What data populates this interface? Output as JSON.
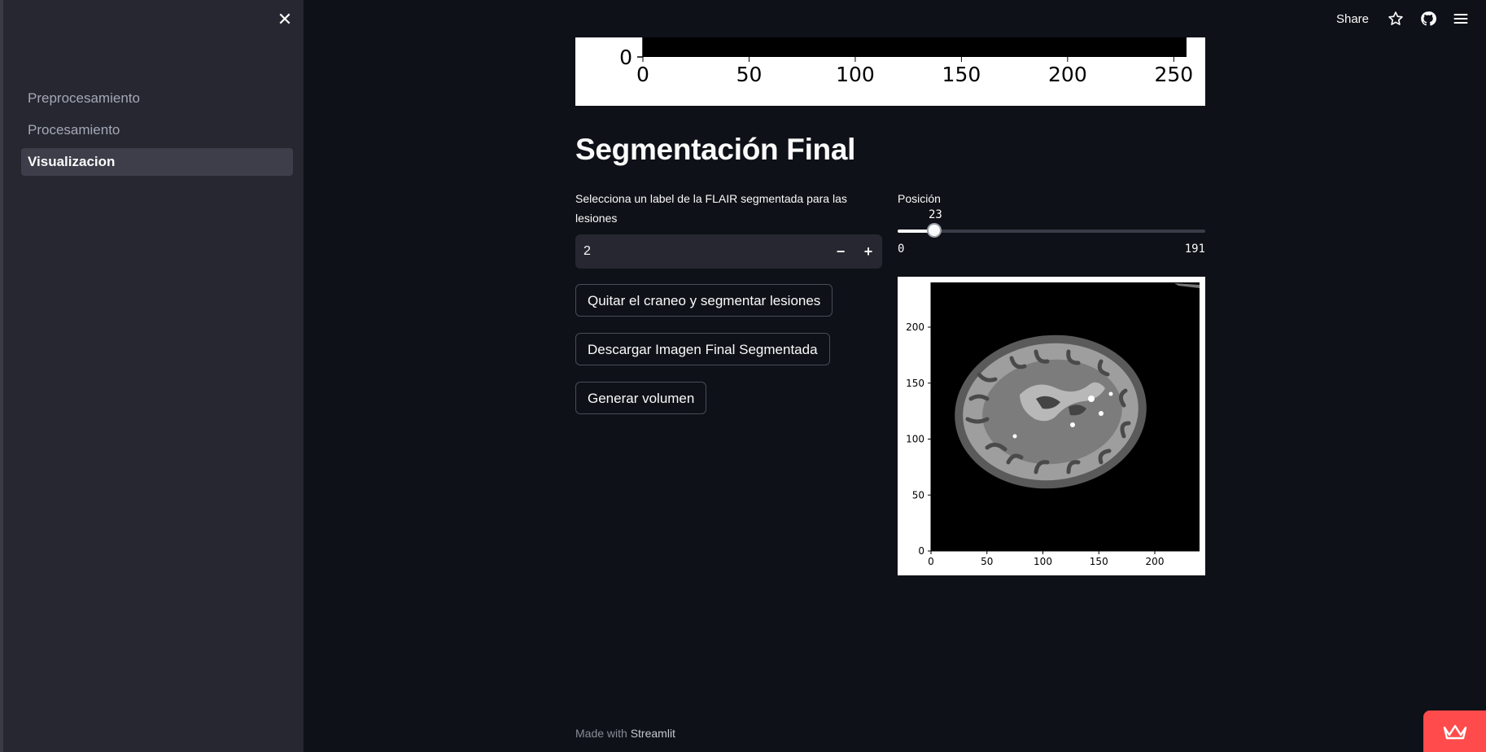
{
  "sidebar": {
    "items": [
      {
        "label": "Preprocesamiento"
      },
      {
        "label": "Procesamiento"
      },
      {
        "label": "Visualizacion"
      }
    ]
  },
  "header": {
    "share_label": "Share"
  },
  "top_plot": {
    "x_ticks": [
      "0",
      "50",
      "100",
      "150",
      "200",
      "250"
    ],
    "y_ticks": [
      "0"
    ]
  },
  "section": {
    "title": "Segmentación Final"
  },
  "label_input": {
    "label": "Selecciona un label de la FLAIR segmentada para las lesiones",
    "value": "2",
    "decrement": "−",
    "increment": "+"
  },
  "buttons": {
    "strip_skull": "Quitar el craneo y segmentar lesiones",
    "download": "Descargar Imagen Final Segmentada",
    "volume": "Generar volumen"
  },
  "slider": {
    "label": "Posición",
    "value": "23",
    "min": "0",
    "max": "191",
    "fraction": 0.12
  },
  "image_plot": {
    "x_ticks": [
      "0",
      "50",
      "100",
      "150",
      "200"
    ],
    "y_ticks": [
      "0",
      "50",
      "100",
      "150",
      "200"
    ]
  },
  "footer": {
    "prefix": "Made with",
    "brand": "Streamlit"
  },
  "colors": {
    "accent": "#ff4b4b",
    "background": "#0e1117",
    "sidebar": "#262730"
  }
}
